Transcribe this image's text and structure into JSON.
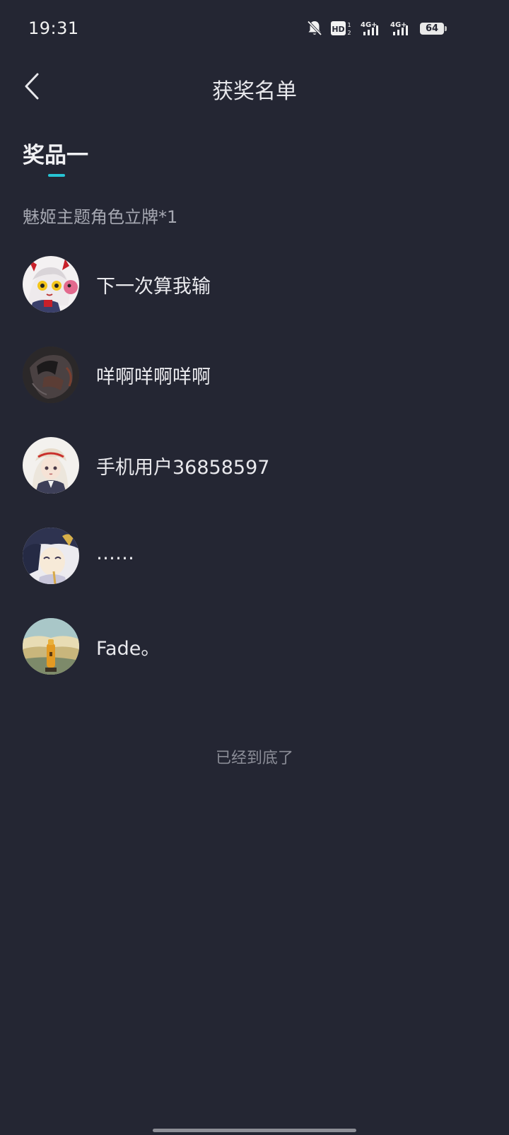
{
  "status_bar": {
    "time": "19:31",
    "icons": [
      "bell-muted-icon",
      "hd-icon",
      "signal-4g-icon",
      "signal-4g-icon"
    ],
    "battery": "64"
  },
  "header": {
    "title": "获奖名单",
    "back_icon": "chevron-left-icon"
  },
  "prize": {
    "tab_label": "奖品一",
    "description": "魅姬主题角色立牌*1",
    "accent_color": "#27c4d4"
  },
  "winners": [
    {
      "name": "下一次算我输"
    },
    {
      "name": "咩啊咩啊咩啊"
    },
    {
      "name": "手机用户36858597"
    },
    {
      "name": "……"
    },
    {
      "name": "Fade。"
    }
  ],
  "footer": {
    "end_text": "已经到底了"
  }
}
